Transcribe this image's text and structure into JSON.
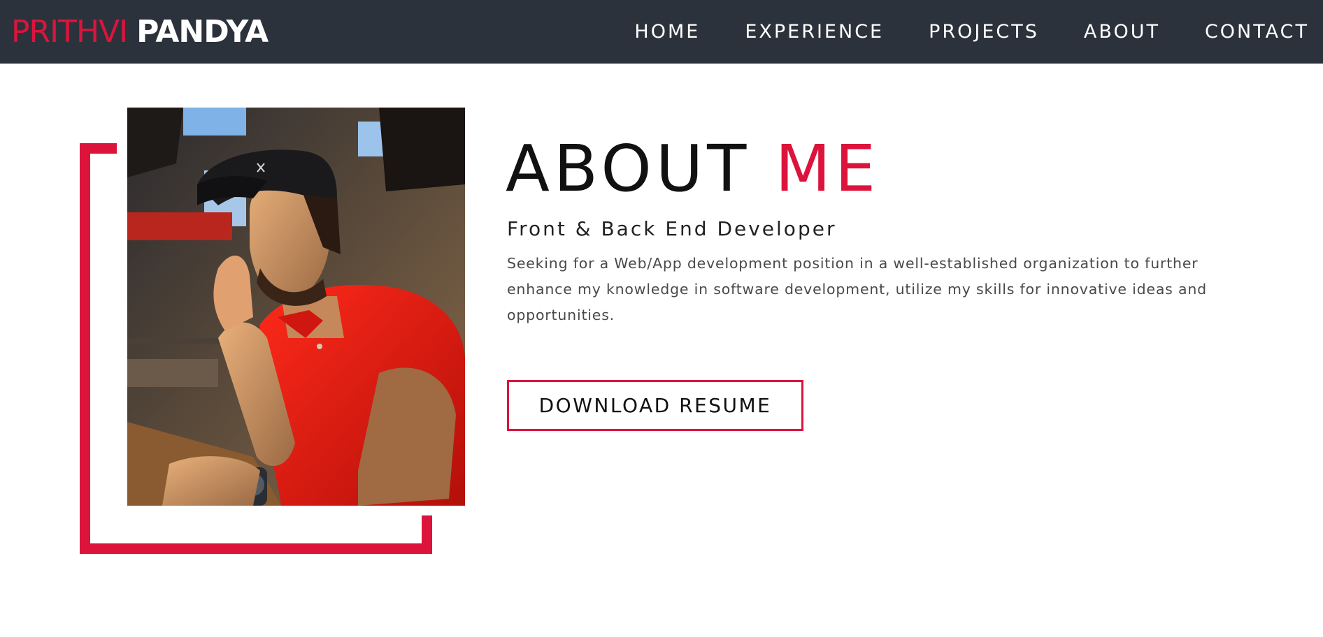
{
  "header": {
    "logo_first": "PRITHVI",
    "logo_last": "PANDYA",
    "nav": [
      {
        "label": "HOME"
      },
      {
        "label": "EXPERIENCE"
      },
      {
        "label": "PROJECTS"
      },
      {
        "label": "ABOUT"
      },
      {
        "label": "CONTACT"
      }
    ]
  },
  "about": {
    "title_main": "ABOUT",
    "title_accent": "ME",
    "subtitle": "Front & Back End Developer",
    "description": "Seeking for a Web/App development position in a well-established organization to further enhance my knowledge in software development, utilize my skills for innovative ideas and opportunities.",
    "resume_button": "DOWNLOAD RESUME"
  },
  "colors": {
    "accent": "#dc143c",
    "navbar_bg": "#2c323c",
    "background": "#ffffff"
  }
}
